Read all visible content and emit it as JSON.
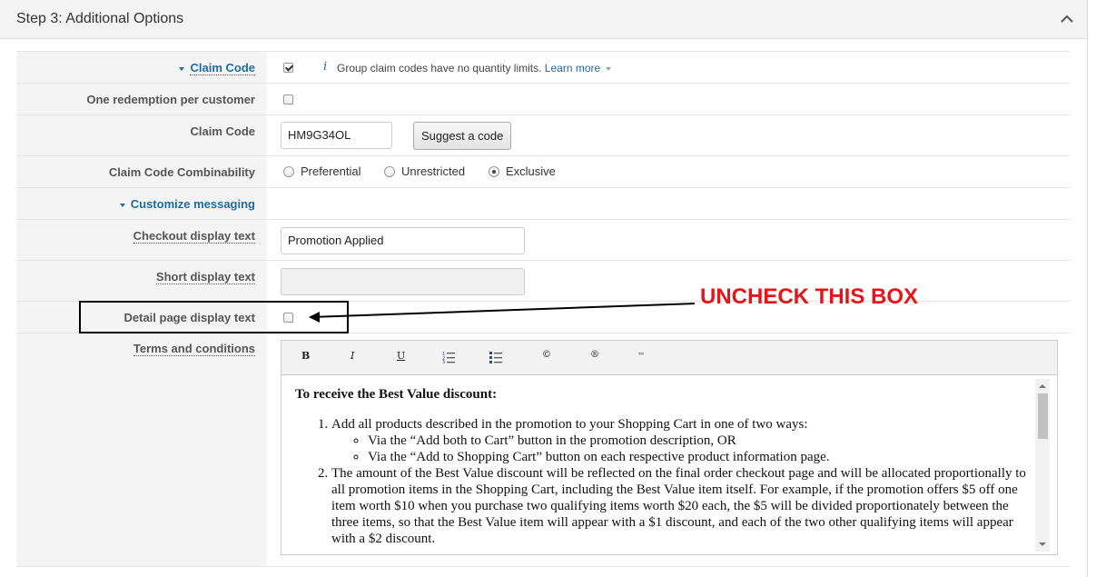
{
  "header": {
    "title": "Step 3: Additional Options"
  },
  "rows": {
    "claim_code_toggle": {
      "label": "Claim Code",
      "info": "Group claim codes have no quantity limits.",
      "learn_more": "Learn more"
    },
    "one_redemption": {
      "label": "One redemption per customer"
    },
    "claim_code": {
      "label": "Claim Code",
      "value": "HM9G34OL",
      "suggest": "Suggest a code"
    },
    "combinability": {
      "label": "Claim Code Combinability",
      "options": [
        "Preferential",
        "Unrestricted",
        "Exclusive"
      ],
      "selected": "Exclusive"
    },
    "customize": {
      "label": "Customize messaging"
    },
    "checkout": {
      "label": "Checkout display text",
      "value": "Promotion Applied"
    },
    "short": {
      "label": "Short display text",
      "value": ""
    },
    "detail": {
      "label": "Detail page display text"
    },
    "terms": {
      "label": "Terms and conditions"
    }
  },
  "editor": {
    "toolbar": [
      "B",
      "I",
      "U",
      "ordered-list-icon",
      "bullet-list-icon",
      "©",
      "®",
      "™"
    ],
    "heading": "To receive the Best Value discount:",
    "item1": "Add all products described in the promotion to your Shopping Cart in one of two ways:",
    "sub1": "Via the “Add both to Cart” button in the promotion description, OR",
    "sub2": "Via the “Add to Shopping Cart” button on each respective product information page.",
    "item2": "The amount of the Best Value discount will be reflected on the final order checkout page and will be allocated proportionally to all promotion items in the Shopping Cart, including the Best Value item itself. For example, if the promotion offers $5 off one item worth $10 when you purchase two qualifying items worth $20 each, the $5 will be divided proportionately between the three items, so that the Best Value item will appear with a $1 discount, and each of the two other qualifying items will appear with a $2 discount."
  },
  "annotation": {
    "text": "UNCHECK THIS BOX"
  },
  "colors": {
    "link": "#1f6aa5",
    "annotation": "#e8141a"
  }
}
